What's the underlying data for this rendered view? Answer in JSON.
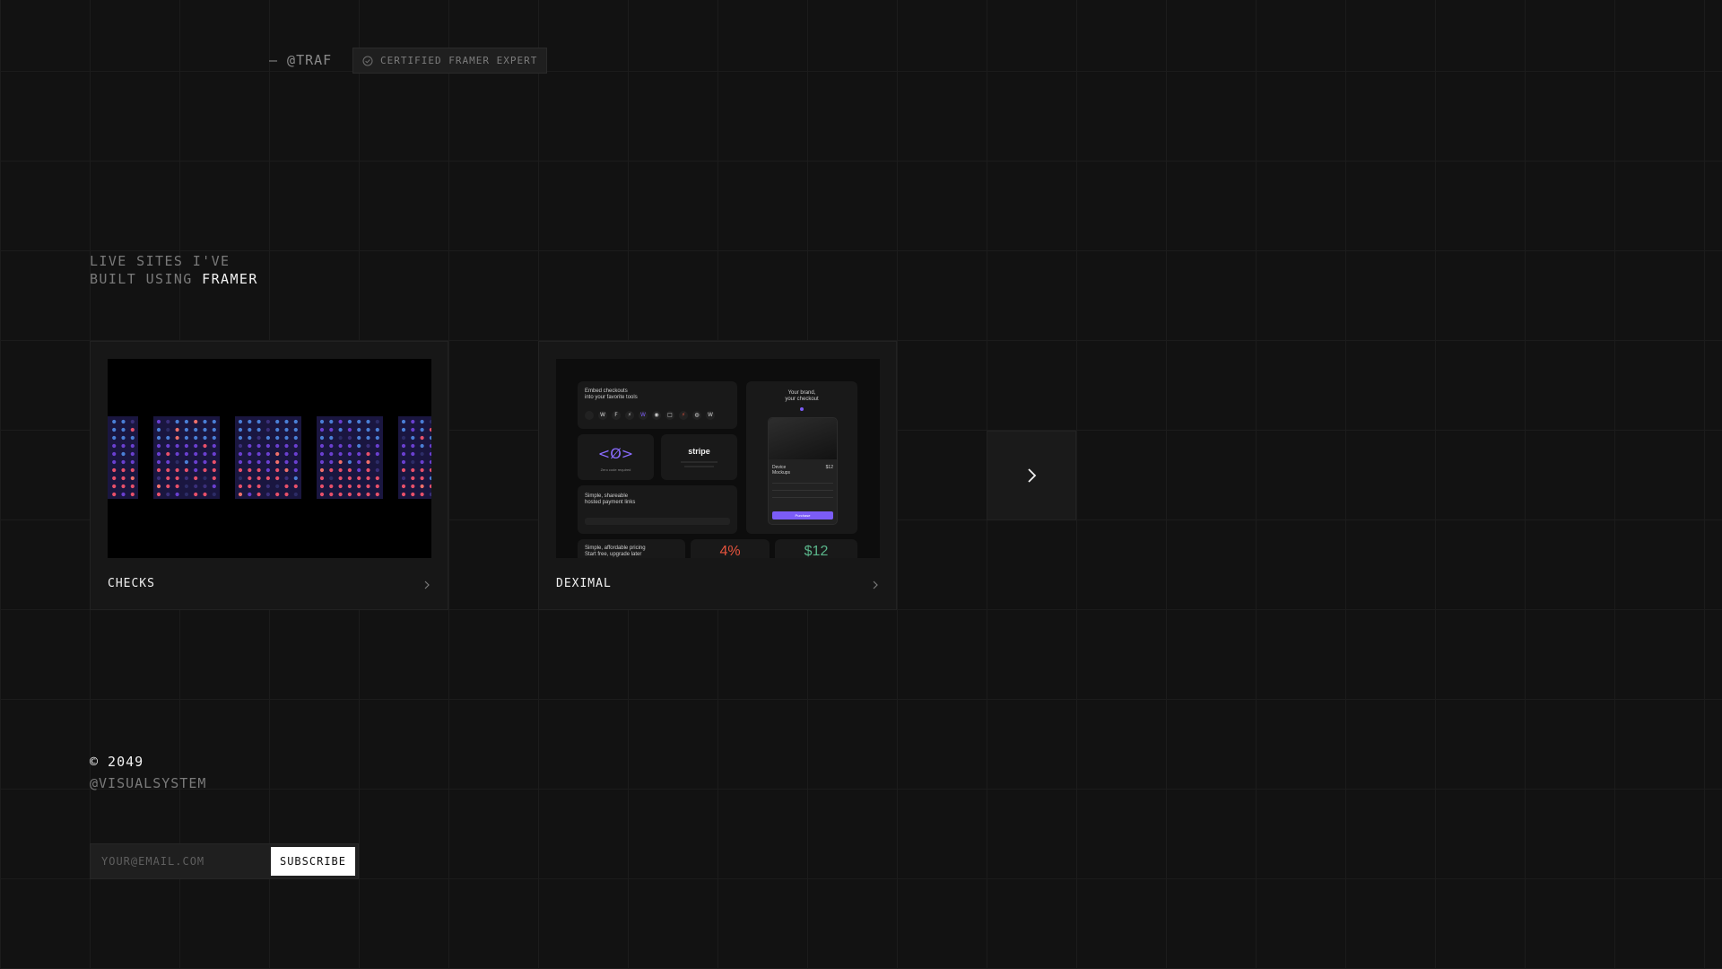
{
  "header": {
    "handle": "— @TRAF",
    "badge_label": "CERTIFIED FRAMER EXPERT",
    "badge_icon": "check-circle-icon"
  },
  "intro": {
    "line1": "LIVE SITES I'VE",
    "line2_prefix": "BUILT USING ",
    "line2_highlight": "FRAMER"
  },
  "projects": [
    {
      "label": "CHECKS",
      "chevron_icon": "chevron-right-icon"
    },
    {
      "label": "DEXIMAL",
      "chevron_icon": "chevron-right-icon",
      "preview": {
        "embed_line1": "Embed checkouts",
        "embed_line2": "into your favorite tools",
        "brand_line1": "Your brand,",
        "brand_line2": "your checkout",
        "code_symbol": "<Ø>",
        "code_caption": "Zero code required",
        "stripe": "stripe",
        "links_line1": "Simple, shareable",
        "links_line2": "hosted payment links",
        "device_line1": "Device",
        "device_line2": "Mockups",
        "device_price": "$12",
        "pricing_line1": "Simple, affordable pricing",
        "pricing_line2": "Start free, upgrade later",
        "stat_percent": "4%",
        "stat_price": "$12",
        "purchase_button": "Purchase"
      }
    }
  ],
  "carousel": {
    "next_icon": "chevron-right-icon"
  },
  "footer": {
    "copyright": "© 2049",
    "handle": "@VISUALSYSTEM",
    "email_placeholder": "YOUR@EMAIL.COM",
    "subscribe_label": "SUBSCRIBE"
  },
  "colors": {
    "background": "#121212",
    "checks_pink": "#e8506a",
    "checks_blue": "#4a7fd6",
    "checks_purple": "#6a3fd0",
    "deximal_accent": "#7b5cf6",
    "deximal_red": "#e5533d",
    "deximal_green": "#5ab58a"
  }
}
